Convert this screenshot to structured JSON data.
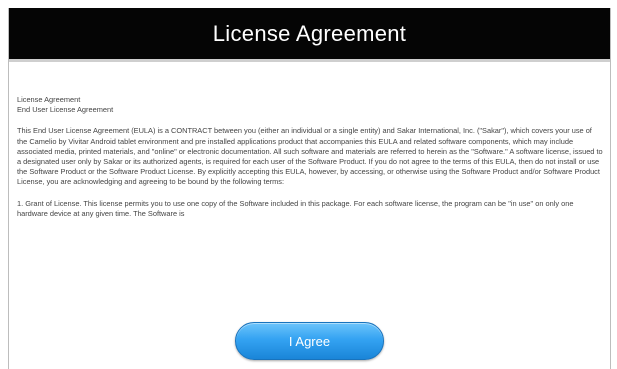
{
  "dialog": {
    "title": "License Agreement"
  },
  "content": {
    "line1": "License Agreement",
    "line2": "End User License Agreement",
    "paragraph1": "This End User License Agreement (EULA) is a CONTRACT between you (either an individual or a single entity) and Sakar International, Inc. (\"Sakar\"), which covers your use of the Camelio by Vivitar Android tablet environment and pre installed applications product that accompanies this EULA and related software components, which may include associated media, printed materials, and \"online\" or electronic documentation. All such software and materials are referred to herein as the \"Software.\" A software license, issued to a designated user only by Sakar or its authorized agents, is required for each user of the Software Product. If you do not agree to the terms of this EULA, then do not install or use the Software Product or the Software Product License. By explicitly accepting this EULA, however, by accessing, or otherwise using the Software Product and/or Software Product License, you are acknowledging and agreeing to be bound by the following terms:",
    "paragraph2": "1. Grant of License. This license permits you to use one copy of the Software included in this package. For each software license, the program can be \"in use\" on only one hardware device at any given time. The Software is"
  },
  "buttons": {
    "agree_label": "I Agree"
  },
  "colors": {
    "title_bar": "#050505",
    "button_blue": "#34a3f2"
  }
}
